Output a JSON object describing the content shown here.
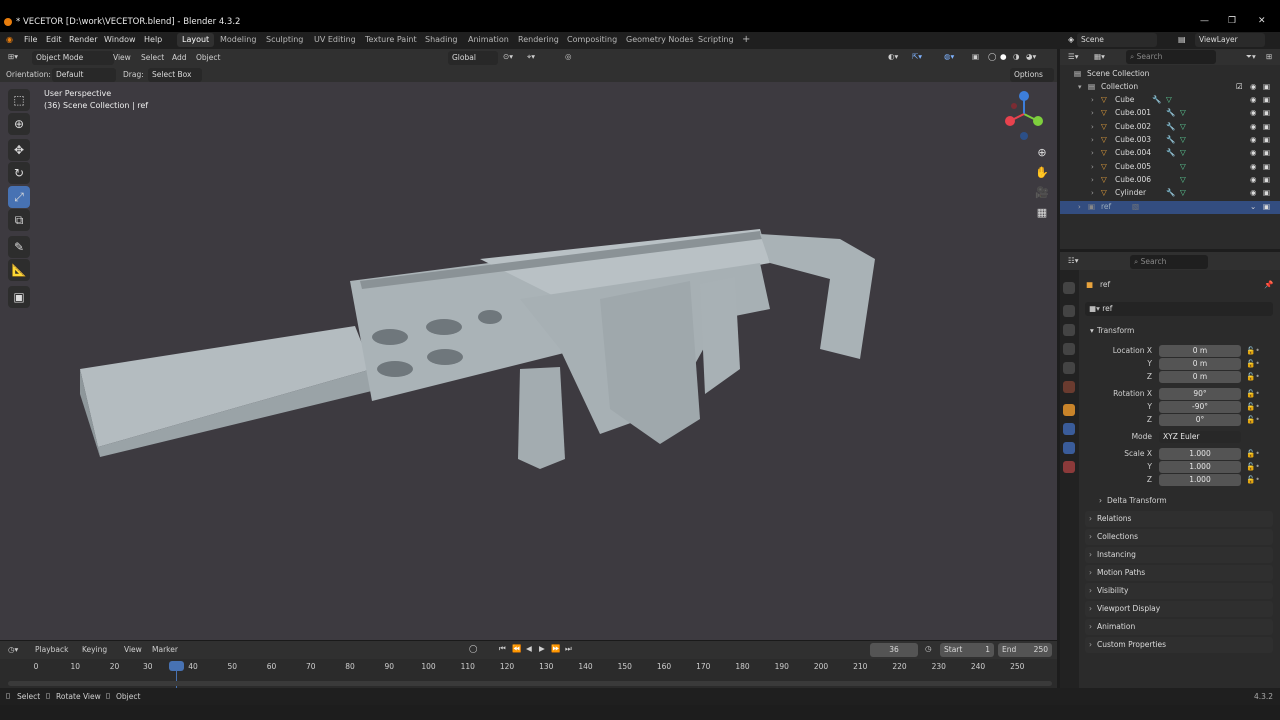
{
  "window": {
    "title": "* VECETOR  [D:\\work\\VECETOR.blend] - Blender 4.3.2",
    "controls": [
      "—",
      "❐",
      "✕"
    ]
  },
  "menubar": {
    "menus": [
      "File",
      "Edit",
      "Render",
      "Window",
      "Help"
    ],
    "workspaces": [
      "Layout",
      "Modeling",
      "Sculpting",
      "UV Editing",
      "Texture Paint",
      "Shading",
      "Animation",
      "Rendering",
      "Compositing",
      "Geometry Nodes",
      "Scripting"
    ],
    "active_workspace": "Layout",
    "add_tab": "+",
    "scene": "Scene",
    "view_layer": "ViewLayer"
  },
  "viewport": {
    "mode": "Object Mode",
    "menus": [
      "View",
      "Select",
      "Add",
      "Object"
    ],
    "transform_orientation": "Global",
    "orientation_label": "Orientation:",
    "orientation_value": "Default",
    "drag_label": "Drag:",
    "drag_value": "Select Box",
    "options": "Options",
    "perspective": "User Perspective",
    "collection_info": "(36) Scene Collection | ref",
    "background_color": "#3d3a40"
  },
  "outliner": {
    "search_placeholder": "Search",
    "root": "Scene Collection",
    "collection": "Collection",
    "objects": [
      "Cube",
      "Cube.001",
      "Cube.002",
      "Cube.003",
      "Cube.004",
      "Cube.005",
      "Cube.006",
      "Cylinder"
    ],
    "selected": "ref"
  },
  "properties": {
    "search_placeholder": "Search",
    "object_name": "ref",
    "data_name": "ref",
    "transform": {
      "title": "Transform",
      "location_label": "Location X",
      "location": [
        "0 m",
        "0 m",
        "0 m"
      ],
      "rotation_label": "Rotation X",
      "rotation": [
        "90°",
        "-90°",
        "0°"
      ],
      "mode_label": "Mode",
      "mode": "XYZ Euler",
      "scale_label": "Scale X",
      "scale": [
        "1.000",
        "1.000",
        "1.000"
      ],
      "axis_y": "Y",
      "axis_z": "Z"
    },
    "delta_transform": "Delta Transform",
    "sections": [
      "Relations",
      "Collections",
      "Instancing",
      "Motion Paths",
      "Visibility",
      "Viewport Display",
      "Animation",
      "Custom Properties"
    ]
  },
  "timeline": {
    "menus": [
      "Playback",
      "Keying",
      "View",
      "Marker"
    ],
    "current_frame": "36",
    "start_label": "Start",
    "start": "1",
    "end_label": "End",
    "end": "250",
    "ticks": [
      "0",
      "10",
      "20",
      "30",
      "40",
      "50",
      "60",
      "70",
      "80",
      "90",
      "100",
      "110",
      "120",
      "130",
      "140",
      "150",
      "160",
      "170",
      "180",
      "190",
      "200",
      "210",
      "220",
      "230",
      "240",
      "250"
    ]
  },
  "statusbar": {
    "items": [
      "Select",
      "Rotate View",
      "Object"
    ],
    "version": "4.3.2"
  },
  "colors": {
    "accent": "#4772b3",
    "selected_row": "#334d80",
    "frame_indicator": "#4772b3",
    "object_icon": "#e8a33d",
    "mesh_icon": "#5ed39b"
  }
}
